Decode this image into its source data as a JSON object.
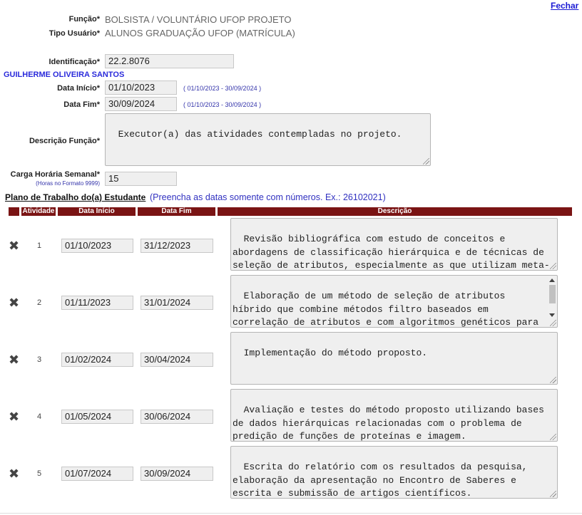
{
  "header": {
    "close_label": "Fechar"
  },
  "form": {
    "funcao_label": "Função*",
    "funcao_value": "BOLSISTA / VOLUNTÁRIO UFOP PROJETO",
    "tipo_label": "Tipo Usuário*",
    "tipo_value": "ALUNOS GRADUAÇÃO UFOP (MATRÍCULA)",
    "ident_label": "Identificação*",
    "ident_value": "22.2.8076",
    "student_name": "GUILHERME OLIVEIRA SANTOS",
    "inicio_label": "Data Início*",
    "inicio_value": "01/10/2023",
    "inicio_hint": "( 01/10/2023 - 30/09/2024 )",
    "fim_label": "Data Fim*",
    "fim_value": "30/09/2024",
    "fim_hint": "( 01/10/2023 - 30/09/2024 )",
    "desc_label": "Descrição Função*",
    "desc_value": "Executor(a) das atividades contempladas no projeto.",
    "carga_label": "Carga Horária Semanal*",
    "carga_sub": "(Horas no Formato 9999)",
    "carga_value": "15"
  },
  "plan": {
    "title": "Plano de Trabalho do(a) Estudante",
    "note": "(Preencha as datas somente com números. Ex.: 26102021)",
    "columns": [
      "Atividade",
      "Data Início",
      "Data Fim",
      "Descrição"
    ],
    "rows": [
      {
        "num": "1",
        "start": "01/10/2023",
        "end": "31/12/2023",
        "desc": "Revisão bibliográfica com estudo de conceitos e abordagens de classificação hierárquica e de técnicas de seleção de atributos, especialmente as que utilizam meta-heurísticas baseadas em algoritmos genéticos"
      },
      {
        "num": "2",
        "start": "01/11/2023",
        "end": "31/01/2024",
        "desc": "Elaboração de um método de seleção de atributos híbrido que combine métodos filtro baseados em correlação de atributos e com algoritmos genéticos para aplicação em bases de dados utilizadas por classificadores"
      },
      {
        "num": "3",
        "start": "01/02/2024",
        "end": "30/04/2024",
        "desc": "Implementação do método proposto."
      },
      {
        "num": "4",
        "start": "01/05/2024",
        "end": "30/06/2024",
        "desc": "Avaliação e testes do método proposto utilizando bases de dados hierárquicas relacionadas com o problema de predição de funções de proteínas e imagem."
      },
      {
        "num": "5",
        "start": "01/07/2024",
        "end": "30/09/2024",
        "desc": "Escrita do relatório com os resultados da pesquisa, elaboração da apresentação no Encontro de Saberes e escrita e submissão de artigos científicos."
      }
    ]
  }
}
